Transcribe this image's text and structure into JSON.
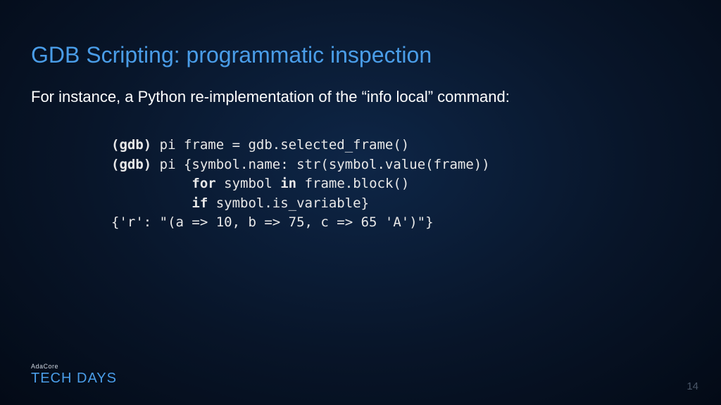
{
  "title": "GDB Scripting: programmatic inspection",
  "subtitle": "For instance, a Python re-implementation of the “info local” command:",
  "code": {
    "l1_prompt": "(gdb)",
    "l1_rest": " pi frame = gdb.selected_frame()",
    "l2_prompt": "(gdb)",
    "l2_rest": " pi {symbol.name: str(symbol.value(frame))",
    "l3_indent": "          ",
    "l3_kw1": "for",
    "l3_mid": " symbol ",
    "l3_kw2": "in",
    "l3_rest": " frame.block()",
    "l4_indent": "          ",
    "l4_kw": "if",
    "l4_rest": " symbol.is_variable}",
    "l5": "{'r': \"(a => 10, b => 75, c => 65 'A')\"}"
  },
  "footer": {
    "brand_top": "AdaCore",
    "brand_main": "TECH DAYS"
  },
  "page_number": "14"
}
